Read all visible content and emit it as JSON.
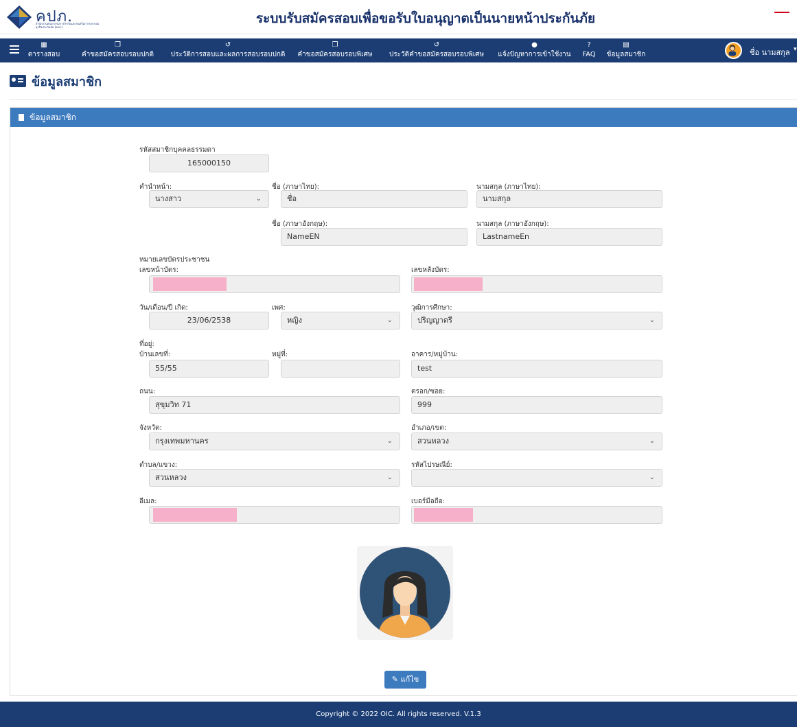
{
  "header": {
    "logo_text": "คปภ.",
    "logo_sub": "สำนักงานคณะกรรมการกำกับและส่งเสริมการประกอบธุรกิจประกันภัย (คปภ.)",
    "site_title": "ระบบรับสมัครสอบเพื่อขอรับใบอนุญาตเป็นนายหน้าประกันภัย"
  },
  "nav": {
    "items": [
      {
        "label": "ตารางสอบ",
        "icon": "calendar-icon"
      },
      {
        "label": "คำขอสมัครสอบรอบปกติ",
        "icon": "copy-icon"
      },
      {
        "label": "ประวัติการสอบและผลการสอบรอบปกติ",
        "icon": "history-icon"
      },
      {
        "label": "คำขอสมัครสอบรอบพิเศษ",
        "icon": "copy-icon"
      },
      {
        "label": "ประวัติคำขอสมัครสอบรอบพิเศษ",
        "icon": "history-icon"
      },
      {
        "label": "แจ้งปัญหาการเข้าใช้งาน",
        "icon": "comment-icon"
      },
      {
        "label": "FAQ",
        "icon": "question-icon"
      },
      {
        "label": "ข้อมูลสมาชิก",
        "icon": "id-card-icon"
      }
    ],
    "user_name": "ชื่อ นามสกุล"
  },
  "page": {
    "title": "ข้อมูลสมาชิก",
    "panel_title": "ข้อมูลสมาชิก"
  },
  "form": {
    "member_id_label": "รหัสสมาชิกบุคคลธรรมดา",
    "member_id": "165000150",
    "prefix_label": "คำนำหน้า:",
    "prefix": "นางสาว",
    "firstname_th_label": "ชื่อ (ภาษาไทย):",
    "firstname_th": "ชื่อ",
    "lastname_th_label": "นามสกุล (ภาษาไทย):",
    "lastname_th": "นามสกุล",
    "firstname_en_label": "ชื่อ (ภาษาอังกฤษ):",
    "firstname_en": "NameEN",
    "lastname_en_label": "นามสกุล (ภาษาอังกฤษ):",
    "lastname_en": "LastnameEn",
    "id_card_section": "หมายเลขบัตรประชาชน",
    "id_front_label": "เลขหน้าบัตร:",
    "id_back_label": "เลขหลังบัตร:",
    "birthdate_label": "วัน/เดือน/ปี เกิด:",
    "birthdate": "23/06/2538",
    "gender_label": "เพศ:",
    "gender": "หญิง",
    "education_label": "วุฒิการศึกษา:",
    "education": "ปริญญาตรี",
    "address_section": "ที่อยู่:",
    "house_no_label": "บ้านเลขที่:",
    "house_no": "55/55",
    "moo_label": "หมู่ที่:",
    "moo": "",
    "building_label": "อาคาร/หมู่บ้าน:",
    "building": "test",
    "road_label": "ถนน:",
    "road": "สุขุมวิท 71",
    "soi_label": "ตรอก/ซอย:",
    "soi": "999",
    "province_label": "จังหวัด:",
    "province": "กรุงเทพมหานคร",
    "district_label": "อำเภอ/เขต:",
    "district": "สวนหลวง",
    "subdistrict_label": "ตำบล/แขวง:",
    "subdistrict": "สวนหลวง",
    "postcode_label": "รหัสไปรษณีย์:",
    "postcode": "",
    "email_label": "อีเมล:",
    "phone_label": "เบอร์มือถือ:"
  },
  "edit_button": "แก้ไข",
  "footer": "Copyright © 2022 OIC. All rights reserved. V.1.3"
}
